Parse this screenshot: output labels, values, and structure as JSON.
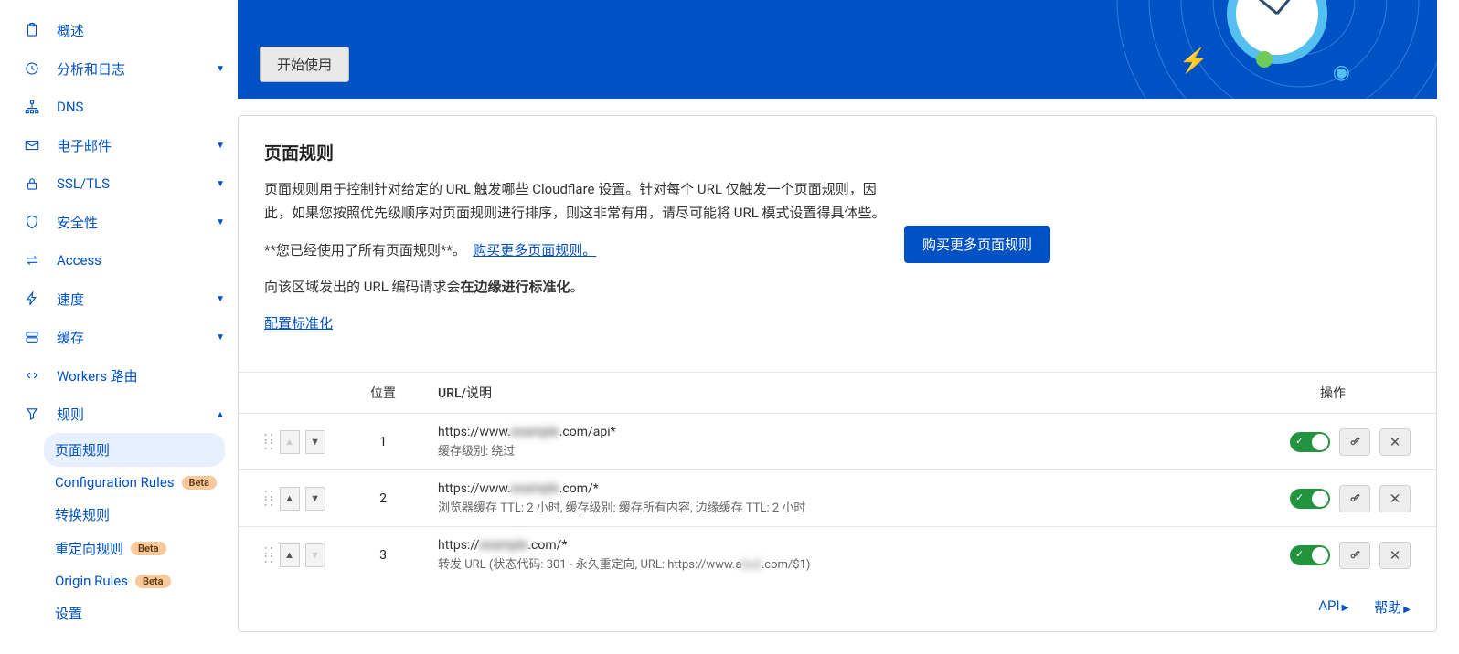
{
  "sidebar": {
    "items": [
      {
        "label": "概述",
        "icon": "clipboard"
      },
      {
        "label": "分析和日志",
        "icon": "clock",
        "expandable": true
      },
      {
        "label": "DNS",
        "icon": "network"
      },
      {
        "label": "电子邮件",
        "icon": "mail",
        "expandable": true
      },
      {
        "label": "SSL/TLS",
        "icon": "lock",
        "expandable": true
      },
      {
        "label": "安全性",
        "icon": "shield",
        "expandable": true
      },
      {
        "label": "Access",
        "icon": "swap"
      },
      {
        "label": "速度",
        "icon": "bolt",
        "expandable": true
      },
      {
        "label": "缓存",
        "icon": "server",
        "expandable": true
      },
      {
        "label": "Workers 路由",
        "icon": "code"
      },
      {
        "label": "规则",
        "icon": "funnel",
        "expandable": true,
        "expanded": true,
        "subs": [
          {
            "label": "页面规则",
            "active": true
          },
          {
            "label": "Configuration Rules",
            "badge": "Beta"
          },
          {
            "label": "转换规则"
          },
          {
            "label": "重定向规则",
            "badge": "Beta"
          },
          {
            "label": "Origin Rules",
            "badge": "Beta"
          },
          {
            "label": "设置"
          }
        ]
      }
    ]
  },
  "hero": {
    "start_label": "开始使用"
  },
  "card": {
    "title": "页面规则",
    "desc": "页面规则用于控制针对给定的 URL 触发哪些 Cloudflare 设置。针对每个 URL 仅触发一个页面规则，因此，如果您按照优先级顺序对页面规则进行排序，则这非常有用，请尽可能将 URL 模式设置得具体些。",
    "used_prefix": "**您已经使用了所有页面规则**。",
    "buy_link": "购买更多页面规则。",
    "norm_prefix": "向该区域发出的 URL 编码请求会",
    "norm_bold": "在边缘进行标准化",
    "norm_suffix": "。",
    "norm_link": "配置标准化",
    "buy_btn": "购买更多页面规则"
  },
  "table": {
    "head_pos": "位置",
    "head_desc": "URL/说明",
    "head_act": "操作",
    "rows": [
      {
        "pos": "1",
        "url_pre": "https://www.",
        "url_blur": "example",
        "url_post": ".com/api*",
        "desc": "缓存级别: 绕过"
      },
      {
        "pos": "2",
        "url_pre": "https://www.",
        "url_blur": "example",
        "url_post": ".com/*",
        "desc": "浏览器缓存 TTL: 2 小时, 缓存级别: 缓存所有内容, 边缘缓存 TTL: 2 小时"
      },
      {
        "pos": "3",
        "url_pre": "https://",
        "url_blur": "example",
        "url_post": ".com/*",
        "desc_pre": "转发 URL (状态代码: 301 - 永久重定向, URL: https://www.a",
        "desc_blur": "bcd",
        "desc_post": ".com/$1)"
      }
    ]
  },
  "footer": {
    "api": "API",
    "help": "帮助"
  }
}
